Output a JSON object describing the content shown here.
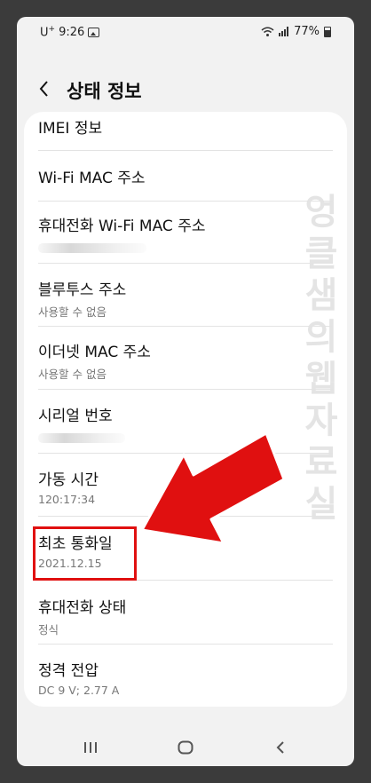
{
  "status": {
    "carrier": "U",
    "carrier_sup": "+",
    "time": "9:26",
    "battery": "77%"
  },
  "header": {
    "title": "상태 정보"
  },
  "items": [
    {
      "title": "IMEI 정보",
      "subtitle": ""
    },
    {
      "title": "Wi-Fi MAC 주소",
      "subtitle": ""
    },
    {
      "title": "휴대전화 Wi-Fi MAC 주소",
      "subtitle": ""
    },
    {
      "title": "블루투스 주소",
      "subtitle": "사용할 수 없음"
    },
    {
      "title": "이더넷 MAC 주소",
      "subtitle": "사용할 수 없음"
    },
    {
      "title": "시리얼 번호",
      "subtitle": ""
    },
    {
      "title": "가동 시간",
      "subtitle": "120:17:34"
    },
    {
      "title": "최초 통화일",
      "subtitle": "2021.12.15"
    },
    {
      "title": "휴대전화 상태",
      "subtitle": "정식"
    },
    {
      "title": "정격 전압",
      "subtitle": "DC 9 V; 2.77 A"
    }
  ],
  "watermark": "엉클샘의웹자료실",
  "annotation_color": "#e01010",
  "nav": {
    "recents": "recents-icon",
    "home": "home-icon",
    "back": "back-icon"
  }
}
